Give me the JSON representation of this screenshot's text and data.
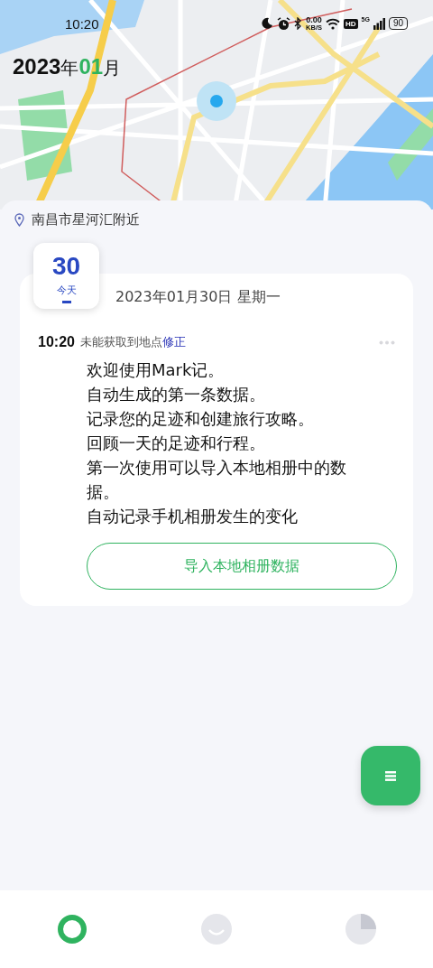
{
  "status_bar": {
    "time": "10:20",
    "speed": "0.00",
    "speed_unit": "KB/S",
    "hd": "HD",
    "network": "5G",
    "battery": "90"
  },
  "map_header": {
    "year": "2023",
    "year_unit": "年",
    "month": "01",
    "month_unit": "月"
  },
  "location": "南昌市星河汇附近",
  "day_badge": {
    "day": "30",
    "label": "今天"
  },
  "date_heading": "2023年01月30日 星期一",
  "entry": {
    "time": "10:20",
    "location_note": "未能获取到地点",
    "fix_link": "修正",
    "lines": [
      "欢迎使用Mark记。",
      "自动生成的第一条数据。",
      "记录您的足迹和创建旅行攻略。",
      "回顾一天的足迹和行程。",
      "第一次使用可以导入本地相册中的数据。",
      "自动记录手机相册发生的变化"
    ]
  },
  "import_button": "导入本地相册数据",
  "bottom_nav": [
    {
      "kind": "ring",
      "selected": true
    },
    {
      "kind": "smile",
      "selected": false
    },
    {
      "kind": "pie",
      "selected": false
    }
  ]
}
